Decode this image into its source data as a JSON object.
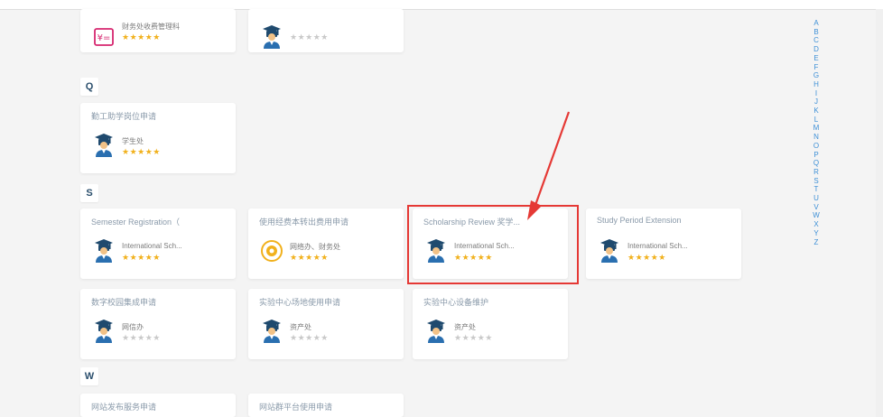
{
  "sections": {
    "q": "Q",
    "s": "S",
    "w": "W"
  },
  "cards": {
    "top1": {
      "title": "",
      "org": "财务处收费管理科",
      "count": "",
      "icon_name": "finance-icon"
    },
    "top2": {
      "title": "",
      "org": "",
      "count": "",
      "icon_name": "graduate-icon"
    },
    "q1": {
      "title": "勤工助学岗位申请",
      "org": "学生处",
      "count": "",
      "icon_name": "graduate-icon"
    },
    "s1": {
      "title": "Semester Registration（",
      "org": "International Sch...",
      "count": "",
      "icon_name": "graduate-icon"
    },
    "s2": {
      "title": "使用经费本转出费用申请",
      "org": "网络办、财务处",
      "count": "",
      "icon_name": "coin-icon"
    },
    "s3": {
      "title": "Scholarship Review 奖学...",
      "org": "International Sch...",
      "count": "",
      "icon_name": "graduate-icon"
    },
    "s4": {
      "title": "Study Period Extension",
      "org": "International Sch...",
      "count": "",
      "icon_name": "graduate-icon"
    },
    "s5": {
      "title": "数字校园集成申请",
      "org": "网信办",
      "count": "",
      "icon_name": "graduate-icon"
    },
    "s6": {
      "title": "实验中心场地使用申请",
      "org": "资产处",
      "count": "",
      "icon_name": "graduate-icon"
    },
    "s7": {
      "title": "实验中心设备维护",
      "org": "资产处",
      "count": "",
      "icon_name": "graduate-icon"
    },
    "w1": {
      "title": "网站发布服务申请",
      "org": "",
      "count": "",
      "icon_name": "graduate-icon"
    },
    "w2": {
      "title": "网站群平台使用申请",
      "org": "",
      "count": "",
      "icon_name": "graduate-icon"
    }
  },
  "ratings": {
    "top1": "★★★★★",
    "top2": "★★★★★",
    "q1": "★★★★★",
    "s1": "★★★★★",
    "s2": "★★★★★",
    "s3": "★★★★★",
    "s4": "★★★★★",
    "s5": "★★★★★",
    "s6": "★★★★★",
    "s7": "★★★★★"
  },
  "alphabet": [
    "A",
    "B",
    "C",
    "D",
    "E",
    "F",
    "G",
    "H",
    "I",
    "J",
    "K",
    "L",
    "M",
    "N",
    "O",
    "P",
    "Q",
    "R",
    "S",
    "T",
    "U",
    "V",
    "W",
    "X",
    "Y",
    "Z"
  ],
  "colors": {
    "accent": "#3d8fd6",
    "star_gold": "#f1b11d",
    "star_gray": "#c9c9c9",
    "highlight_red": "#e53935",
    "letter_text": "#2a4e6c"
  }
}
